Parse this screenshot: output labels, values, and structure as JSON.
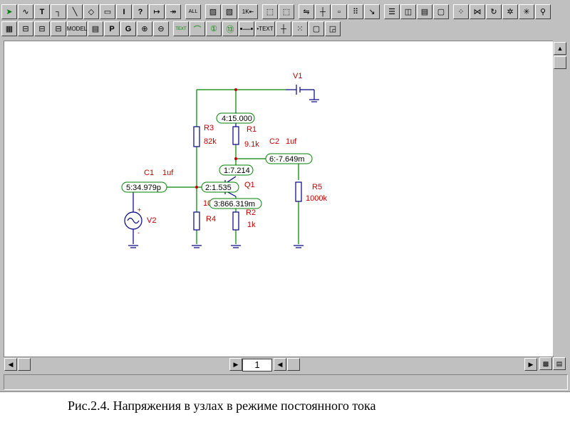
{
  "toolbar": {
    "row1": [
      "pointer",
      "wire",
      "text-T",
      "corner",
      "line",
      "dots",
      "rect",
      "I",
      "?",
      "arrow",
      "arrow2",
      "ALL",
      "hatch",
      "hatch2",
      "1K",
      "box1",
      "box2",
      "loop",
      "cross",
      "sq",
      "dots2",
      "pen",
      "win1",
      "win2",
      "win3",
      "win4",
      "w5",
      "w6",
      "w7",
      "w8",
      "w9",
      "probe"
    ],
    "row2_labels": {
      "model": "MODEL",
      "p": "P",
      "g": "G",
      "text1": "TEXT",
      "text2": "•TEXT"
    }
  },
  "page_number": "1",
  "caption": "Рис.2.4. Напряжения в узлах в режиме постоянного тока",
  "circuit": {
    "v1": "V1",
    "v2": "V2",
    "r1": "R1",
    "r1_val": "9.1k",
    "r2": "R2",
    "r2_val": "1k",
    "r3": "R3",
    "r3_val": "82k",
    "r4": "R4",
    "r4_val_partial": "10",
    "r5": "R5",
    "r5_val": "1000k",
    "c1": "C1",
    "c1_val": "1uf",
    "c2": "C2",
    "c2_val": "1uf",
    "q1": "Q1",
    "node1": "1:7.214",
    "node2": "2:1.535",
    "node3": "3:866.319m",
    "node4": "4:15.000",
    "node5": "5:34.979p",
    "node6": "6:-7.649m"
  },
  "colors": {
    "wire": "#008000",
    "label": "#c00000",
    "part": "#000080"
  }
}
